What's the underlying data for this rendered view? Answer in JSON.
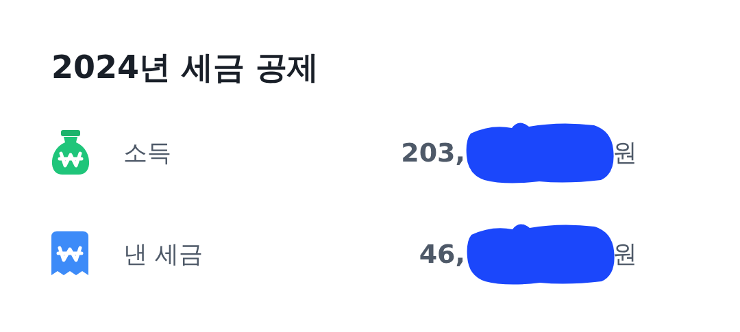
{
  "title": "2024년 세금 공제",
  "rows": [
    {
      "kind": "income",
      "label": "소득",
      "amount": "203,",
      "redacted": true,
      "unit": "원"
    },
    {
      "kind": "tax_paid",
      "label": "낸 세금",
      "amount": "46,",
      "redacted": true,
      "unit": "원"
    }
  ]
}
